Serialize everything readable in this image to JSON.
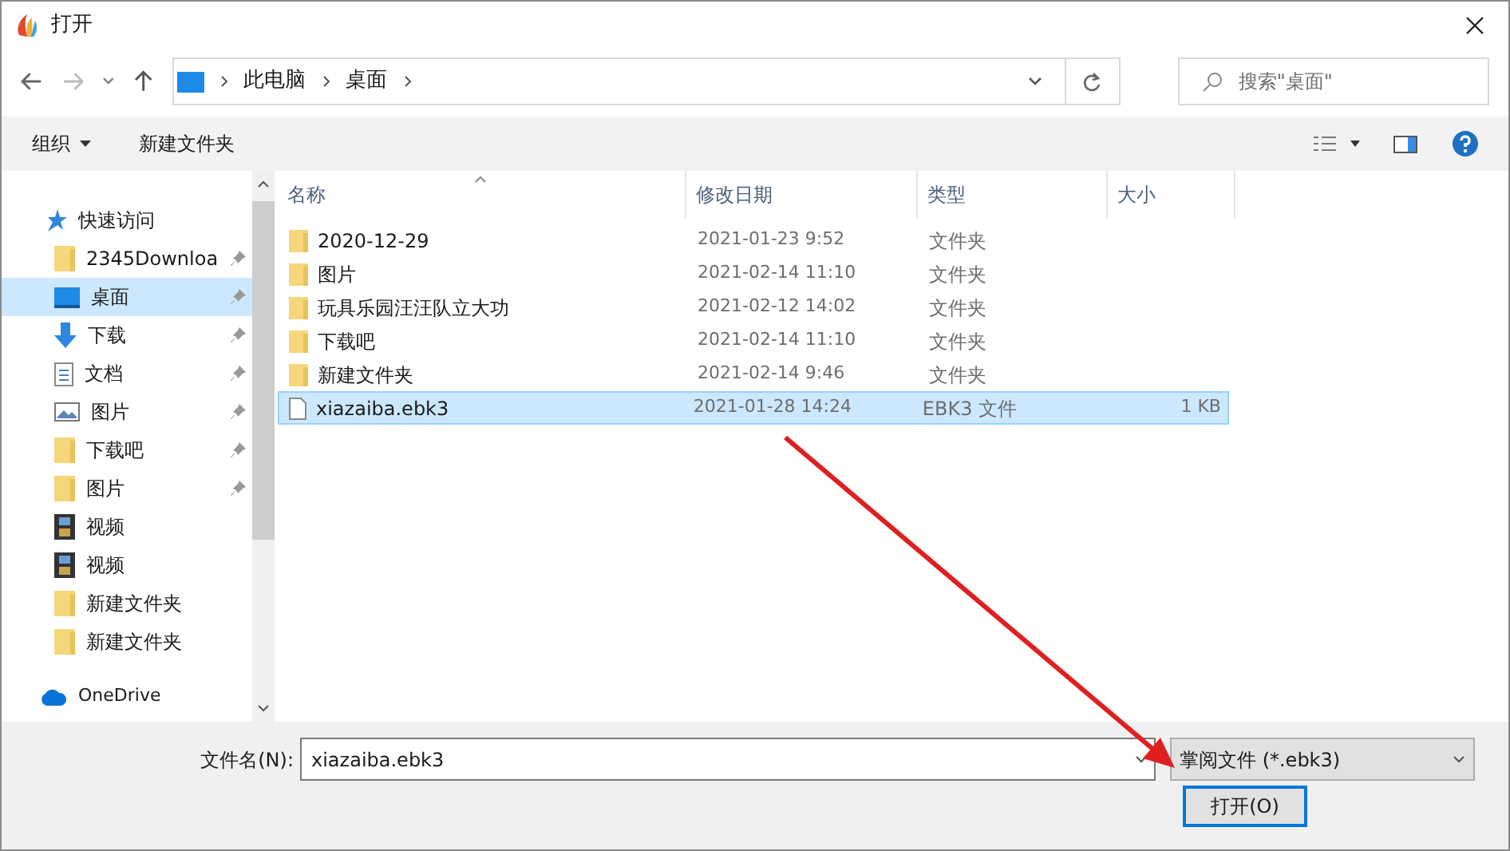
{
  "window": {
    "title": "打开"
  },
  "address": {
    "crumbs": [
      "此电脑",
      "桌面"
    ]
  },
  "search": {
    "placeholder": "搜索\"桌面\""
  },
  "toolbar": {
    "organize": "组织",
    "new_folder": "新建文件夹"
  },
  "sidebar": {
    "items": [
      {
        "kind": "quick",
        "label": "快速访问",
        "pinned": false,
        "selected": false
      },
      {
        "kind": "folder",
        "label": "2345Downloa",
        "pinned": true,
        "selected": false
      },
      {
        "kind": "desktop",
        "label": "桌面",
        "pinned": true,
        "selected": true
      },
      {
        "kind": "download",
        "label": "下载",
        "pinned": true,
        "selected": false
      },
      {
        "kind": "document",
        "label": "文档",
        "pinned": true,
        "selected": false
      },
      {
        "kind": "picture",
        "label": "图片",
        "pinned": true,
        "selected": false
      },
      {
        "kind": "folder",
        "label": "下载吧",
        "pinned": true,
        "selected": false
      },
      {
        "kind": "folder",
        "label": "图片",
        "pinned": true,
        "selected": false
      },
      {
        "kind": "video",
        "label": "视频",
        "pinned": false,
        "selected": false
      },
      {
        "kind": "video",
        "label": "视频",
        "pinned": false,
        "selected": false
      },
      {
        "kind": "folder",
        "label": "新建文件夹",
        "pinned": false,
        "selected": false
      },
      {
        "kind": "folder",
        "label": "新建文件夹",
        "pinned": false,
        "selected": false
      },
      {
        "kind": "onedrive",
        "label": "OneDrive",
        "pinned": false,
        "selected": false
      }
    ]
  },
  "table": {
    "columns": [
      "名称",
      "修改日期",
      "类型",
      "大小"
    ],
    "rows": [
      {
        "kind": "folder",
        "name": "2020-12-29",
        "modified": "2021-01-23 9:52",
        "type": "文件夹",
        "selected": false
      },
      {
        "kind": "folder",
        "name": "图片",
        "modified": "2021-02-14 11:10",
        "type": "文件夹",
        "selected": false
      },
      {
        "kind": "folder",
        "name": "玩具乐园汪汪队立大功",
        "modified": "2021-02-12 14:02",
        "type": "文件夹",
        "selected": false
      },
      {
        "kind": "folder",
        "name": "下载吧",
        "modified": "2021-02-14 11:10",
        "type": "文件夹",
        "selected": false
      },
      {
        "kind": "folder",
        "name": "新建文件夹",
        "modified": "2021-02-14 9:46",
        "type": "文件夹",
        "selected": false
      },
      {
        "kind": "file",
        "name": "xiazaiba.ebk3",
        "modified": "2021-01-28 14:24",
        "type": "EBK3 文件",
        "size": "1 KB",
        "selected": true
      }
    ]
  },
  "footer": {
    "filename_label": "文件名(N):",
    "filename": "xiazaiba.ebk3",
    "filter": "掌阅文件 (*.ebk3)",
    "open_button": "打开(O)"
  }
}
